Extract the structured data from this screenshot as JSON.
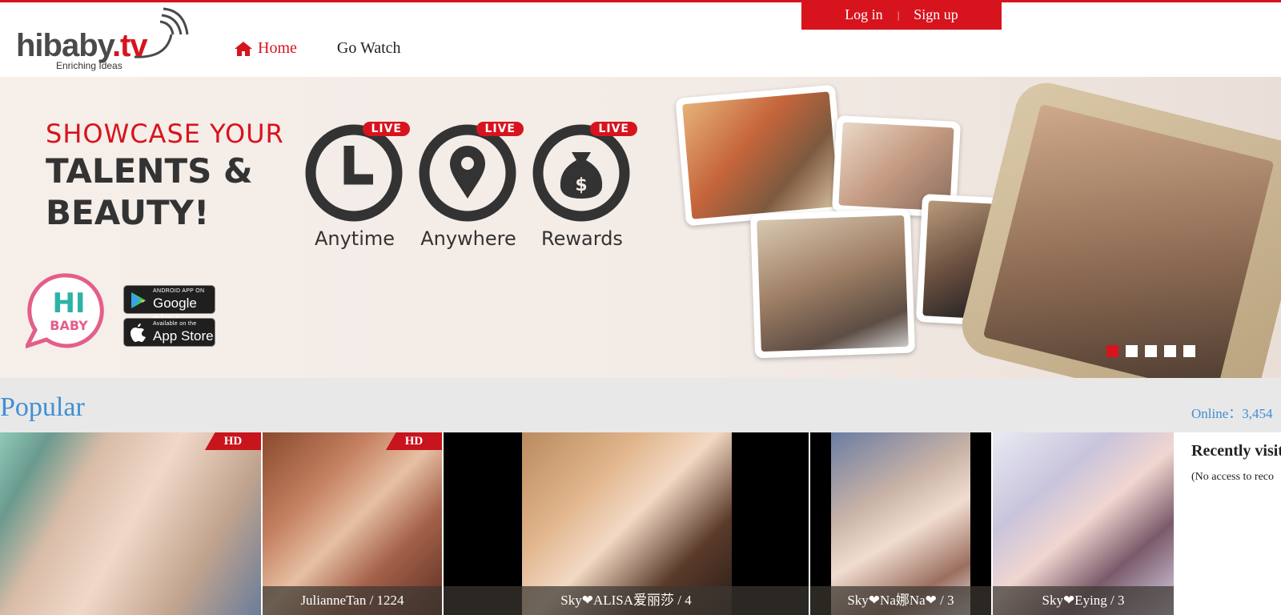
{
  "header": {
    "logo_text_main": "hibaby",
    "logo_text_tv": ".tv",
    "logo_tagline": "Enriching Ideas",
    "nav": [
      {
        "label": "Home",
        "active": true
      },
      {
        "label": "Go Watch",
        "active": false
      }
    ],
    "auth": {
      "login_label": "Log in",
      "separator": "|",
      "signup_label": "Sign up"
    }
  },
  "banner": {
    "headline_line1": "SHOWCASE YOUR",
    "headline_line2": "TALENTS &",
    "headline_line3": "BEAUTY!",
    "features": [
      {
        "label": "Anytime",
        "badge": "LIVE",
        "icon": "clock-icon"
      },
      {
        "label": "Anywhere",
        "badge": "LIVE",
        "icon": "location-pin-icon"
      },
      {
        "label": "Rewards",
        "badge": "LIVE",
        "icon": "money-bag-icon"
      }
    ],
    "badge_line1": "HI",
    "badge_line2": "BABY",
    "google_play": {
      "small": "ANDROID APP ON",
      "big": "Google play"
    },
    "app_store": {
      "small": "Available on the",
      "big": "App Store"
    },
    "slides_total": 5,
    "slide_active": 1
  },
  "popular": {
    "title": "Popular",
    "online_text": "Online：3,454"
  },
  "cards": [
    {
      "hd": "HD",
      "caption": ""
    },
    {
      "hd": "HD",
      "caption": "JulianneTan / 1224"
    },
    {
      "hd": "",
      "caption": "Sky❤ALISA爱丽莎 / 4"
    },
    {
      "hd": "",
      "caption": "Sky❤Na娜Na❤ / 3"
    },
    {
      "hd": "",
      "caption": "Sky❤Eying / 3"
    }
  ],
  "recent": {
    "title": "Recently visit",
    "note": "(No access to reco"
  },
  "colors": {
    "brand_red": "#d7141e",
    "link_blue": "#3f8fd2"
  }
}
